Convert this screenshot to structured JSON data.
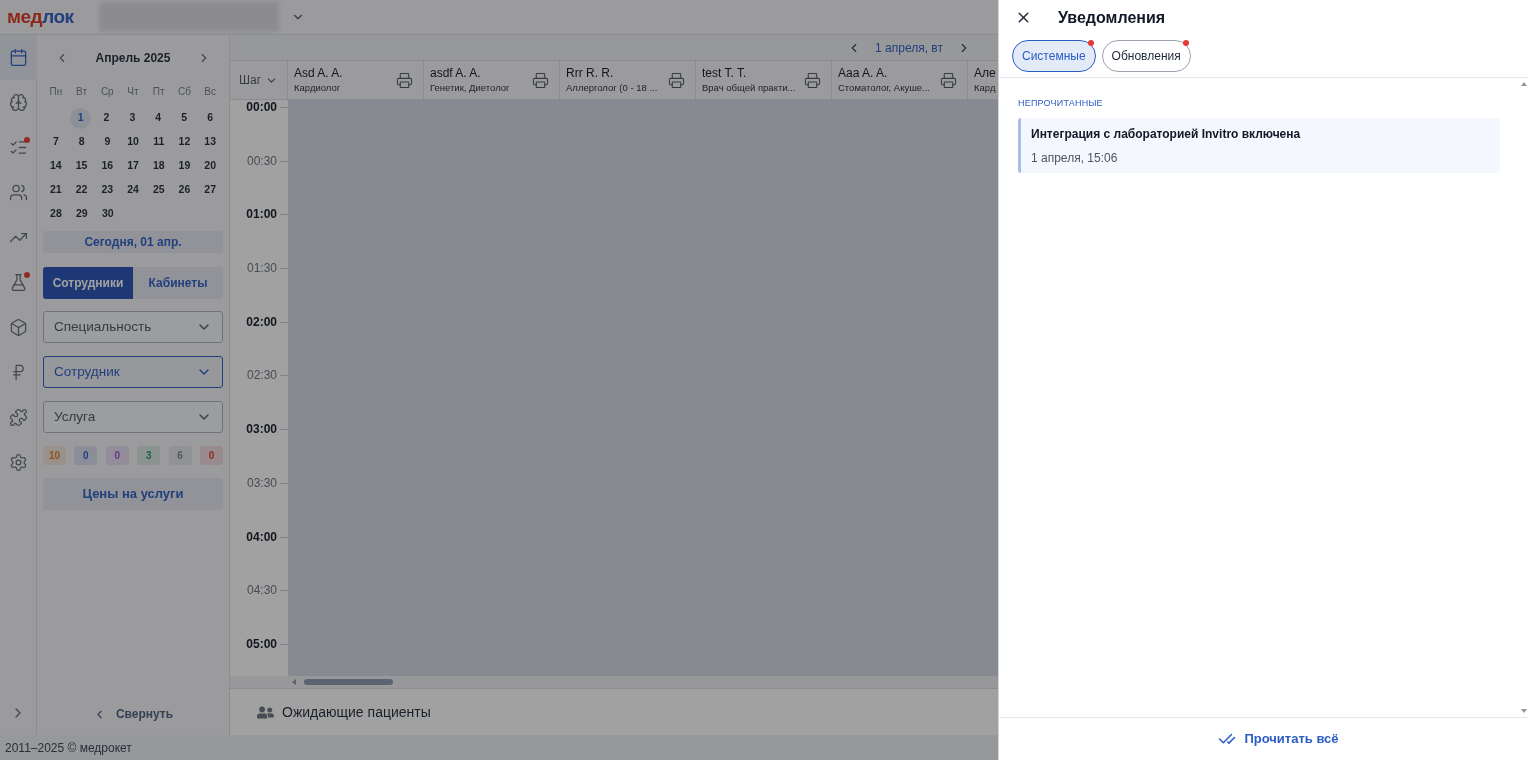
{
  "header": {
    "logo": [
      {
        "text": "мед",
        "color": "#8b2819"
      },
      {
        "text": "лок",
        "color": "#223f7e"
      }
    ]
  },
  "nav_rail": {
    "items": [
      {
        "selected": true,
        "badge": false
      },
      {
        "selected": false,
        "badge": false
      },
      {
        "selected": false,
        "badge": true
      },
      {
        "selected": false,
        "badge": false
      },
      {
        "selected": false,
        "badge": false
      },
      {
        "selected": false,
        "badge": true
      },
      {
        "selected": false,
        "badge": false
      },
      {
        "selected": false,
        "badge": false
      },
      {
        "selected": false,
        "badge": false
      },
      {
        "selected": false,
        "badge": false
      }
    ]
  },
  "calendar": {
    "month": "Апрель 2025",
    "weekdays": [
      "Пн",
      "Вт",
      "Ср",
      "Чт",
      "Пт",
      "Сб",
      "Вс"
    ],
    "weeks": [
      {
        "starts_midweek": true,
        "days": [
          {
            "day": "1",
            "selected": true
          },
          {
            "day": "2",
            "selected": false
          },
          {
            "day": "3",
            "selected": false
          },
          {
            "day": "4",
            "selected": false
          },
          {
            "day": "5",
            "selected": false
          },
          {
            "day": "6",
            "selected": false
          }
        ]
      },
      {
        "starts_midweek": false,
        "days": [
          {
            "day": "7",
            "selected": false
          },
          {
            "day": "8",
            "selected": false
          },
          {
            "day": "9",
            "selected": false
          },
          {
            "day": "10",
            "selected": false
          },
          {
            "day": "11",
            "selected": false
          },
          {
            "day": "12",
            "selected": false
          },
          {
            "day": "13",
            "selected": false
          }
        ]
      },
      {
        "starts_midweek": false,
        "days": [
          {
            "day": "14",
            "selected": false
          },
          {
            "day": "15",
            "selected": false
          },
          {
            "day": "16",
            "selected": false
          },
          {
            "day": "17",
            "selected": false
          },
          {
            "day": "18",
            "selected": false
          },
          {
            "day": "19",
            "selected": false
          },
          {
            "day": "20",
            "selected": false
          }
        ]
      },
      {
        "starts_midweek": false,
        "days": [
          {
            "day": "21",
            "selected": false
          },
          {
            "day": "22",
            "selected": false
          },
          {
            "day": "23",
            "selected": false
          },
          {
            "day": "24",
            "selected": false
          },
          {
            "day": "25",
            "selected": false
          },
          {
            "day": "26",
            "selected": false
          },
          {
            "day": "27",
            "selected": false
          }
        ]
      },
      {
        "starts_midweek": false,
        "days": [
          {
            "day": "28",
            "selected": false
          },
          {
            "day": "29",
            "selected": false
          },
          {
            "day": "30",
            "selected": false
          }
        ]
      }
    ],
    "today_button": "Сегодня, 01 апр."
  },
  "view_tabs": [
    {
      "label": "Сотрудники",
      "selected": true
    },
    {
      "label": "Кабинеты",
      "selected": false
    }
  ],
  "filters": [
    {
      "placeholder": "Специальность",
      "highlighted": false
    },
    {
      "placeholder": "Сотрудник",
      "highlighted": true
    },
    {
      "placeholder": "Услуга",
      "highlighted": false
    }
  ],
  "counters": [
    {
      "value": "10",
      "color": "#8e521c"
    },
    {
      "value": "0",
      "color": "#223f7e"
    },
    {
      "value": "0",
      "color": "#653788"
    },
    {
      "value": "3",
      "color": "#1b643e"
    },
    {
      "value": "6",
      "color": "#515864"
    },
    {
      "value": "0",
      "color": "#8e2822"
    }
  ],
  "prices_button": "Цены на услуги",
  "collapse_button": "Свернуть",
  "footer": "2011–2025 © медрокет",
  "schedule": {
    "date": "1 апреля, вт",
    "step_label": "Шаг",
    "columns": [
      {
        "name": "Asd A. A.",
        "specialty": "Кардиолог",
        "kind": "full"
      },
      {
        "name": "asdf A. A.",
        "specialty": "Генетик, Диетолог",
        "kind": "full"
      },
      {
        "name": "Rrr R. R.",
        "specialty": "Аллерголог (0 - 18 ...",
        "kind": "full"
      },
      {
        "name": "test T. T.",
        "specialty": "Врач общей практи...",
        "kind": "full"
      },
      {
        "name": "Aaa A. A.",
        "specialty": "Стоматолог, Акуше...",
        "kind": "full"
      },
      {
        "name": "Але",
        "specialty": "Кард",
        "kind": "cut"
      }
    ],
    "time_slots": [
      {
        "time": "00:00",
        "kind": "hour"
      },
      {
        "time": "00:30",
        "kind": "half"
      },
      {
        "time": "01:00",
        "kind": "hour"
      },
      {
        "time": "01:30",
        "kind": "half"
      },
      {
        "time": "02:00",
        "kind": "hour"
      },
      {
        "time": "02:30",
        "kind": "half"
      },
      {
        "time": "03:00",
        "kind": "hour"
      },
      {
        "time": "03:30",
        "kind": "half"
      },
      {
        "time": "04:00",
        "kind": "hour"
      },
      {
        "time": "04:30",
        "kind": "half"
      },
      {
        "time": "05:00",
        "kind": "hour"
      }
    ]
  },
  "waiting_patients": "Ожидающие пациенты",
  "notifications": {
    "title": "Уведомления",
    "tabs": [
      {
        "label": "Системные",
        "selected": true,
        "unread": true
      },
      {
        "label": "Обновления",
        "selected": false,
        "unread": true
      }
    ],
    "section": "НЕПРОЧИТАННЫЕ",
    "items": [
      {
        "title": "Интеграция с лабораторией Invitro включена",
        "time": "1 апреля, 15:06",
        "unread": true
      }
    ],
    "mark_all_button": "Прочитать всё"
  }
}
